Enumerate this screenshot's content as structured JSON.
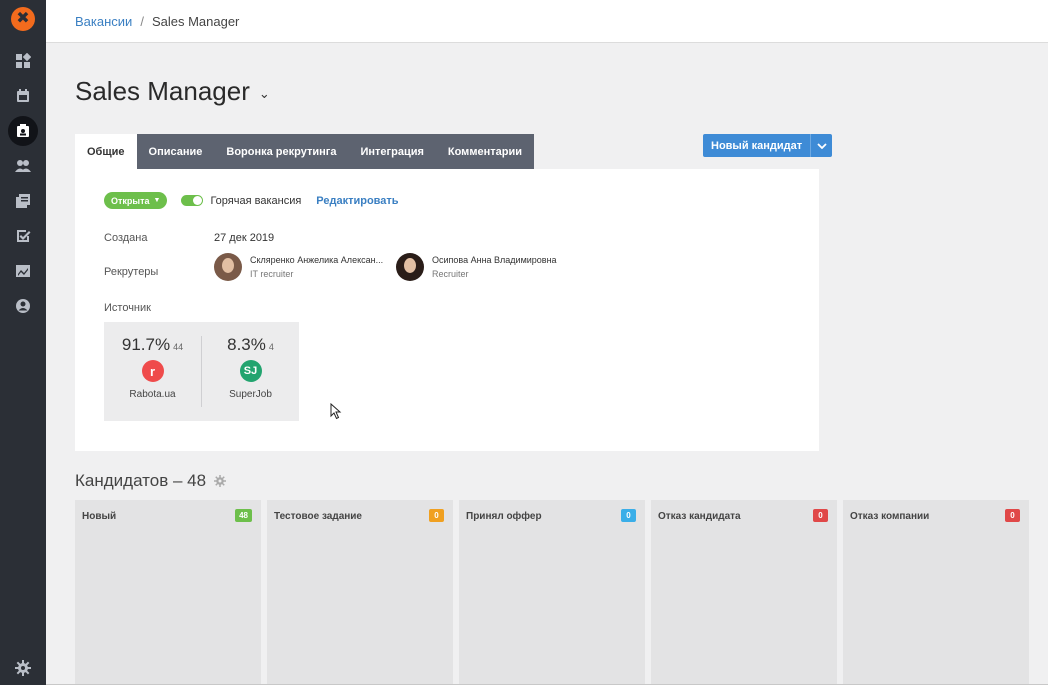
{
  "breadcrumb": {
    "parent": "Вакансии",
    "separator": "/",
    "current": "Sales Manager"
  },
  "title": "Sales Manager",
  "tabs": [
    {
      "label": "Общие",
      "active": true
    },
    {
      "label": "Описание",
      "active": false
    },
    {
      "label": "Воронка рекрутинга",
      "active": false
    },
    {
      "label": "Интеграция",
      "active": false
    },
    {
      "label": "Комментарии",
      "active": false
    }
  ],
  "new_candidate": {
    "label": "Новый кандидат"
  },
  "status": {
    "label": "Открыта",
    "hot_label": "Горячая вакансия",
    "hot_enabled": true,
    "edit_label": "Редактировать"
  },
  "created": {
    "label": "Создана",
    "value": "27 дек 2019"
  },
  "recruiters": {
    "label": "Рекрутеры",
    "items": [
      {
        "name": "Скляренко Анжелика Алексан...",
        "role": "IT recruiter"
      },
      {
        "name": "Осипова Анна Владимировна",
        "role": "Recruiter"
      }
    ]
  },
  "source": {
    "label": "Источник",
    "items": [
      {
        "percent": "91.7%",
        "count": "44",
        "name": "Rabota.ua",
        "logo_text": "r",
        "color": "#ef4b4b"
      },
      {
        "percent": "8.3%",
        "count": "4",
        "name": "SuperJob",
        "logo_text": "SJ",
        "color": "#22a46f"
      }
    ]
  },
  "candidates": {
    "title": "Кандидатов – 48",
    "columns": [
      {
        "name": "Новый",
        "count": "48",
        "color": "#6dbf4b"
      },
      {
        "name": "Тестовое задание",
        "count": "0",
        "color": "#f0a020"
      },
      {
        "name": "Принял оффер",
        "count": "0",
        "color": "#3aaee8"
      },
      {
        "name": "Отказ кандидата",
        "count": "0",
        "color": "#e04848"
      },
      {
        "name": "Отказ компании",
        "count": "0",
        "color": "#e04848"
      }
    ]
  },
  "colors": {
    "sidebar": "#2b2f36",
    "accent": "#3e8bd6",
    "logo": "#f26b1d",
    "tabs_bg": "#5d6370"
  }
}
